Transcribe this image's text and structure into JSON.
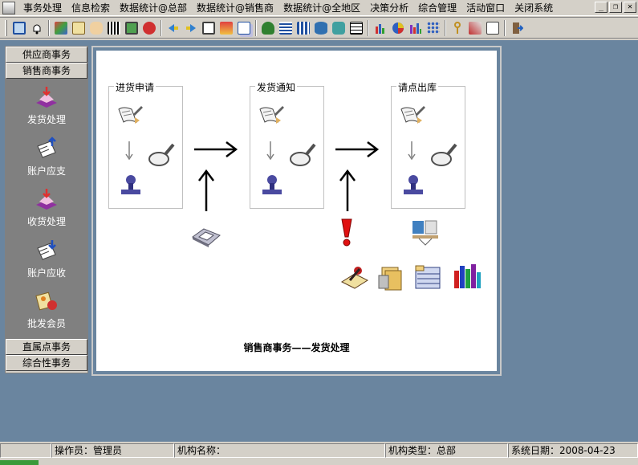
{
  "menubar": {
    "items": [
      "事务处理",
      "信息检索",
      "数据统计@总部",
      "数据统计@销售商",
      "数据统计@全地区",
      "决策分析",
      "综合管理",
      "活动窗口",
      "关闭系统"
    ]
  },
  "window_controls": {
    "minimize": "_",
    "restore": "❐",
    "close": "✕"
  },
  "toolbar": {
    "icons": [
      "window-icon",
      "bell-icon",
      "people-icon",
      "search-doc-icon",
      "hand-icon",
      "barcode-icon",
      "monitor-icon",
      "cart-icon",
      "arrow-left-icon",
      "arrow-right-icon",
      "print-icon",
      "layers-icon",
      "copy-icon",
      "money-bag-icon",
      "grid-icon",
      "columns-icon",
      "database-icon",
      "database-group-icon",
      "table-icon",
      "bar-chart-icon",
      "pie-chart-icon",
      "column-chart-icon",
      "dot-grid-icon",
      "key-icon",
      "tools-icon",
      "properties-icon",
      "exit-icon"
    ]
  },
  "leftpanel": {
    "sections": {
      "supplier": "供应商事务",
      "dealer": "销售商事务",
      "direct": "直属点事务",
      "general": "综合性事务"
    },
    "items": [
      {
        "label": "发货处理",
        "icon": "ship-icon"
      },
      {
        "label": "账户应支",
        "icon": "pay-icon"
      },
      {
        "label": "收货处理",
        "icon": "receive-icon"
      },
      {
        "label": "账户应收",
        "icon": "receivable-icon"
      },
      {
        "label": "批发会员",
        "icon": "member-icon"
      }
    ]
  },
  "workflow": {
    "groups": [
      "进货申请",
      "发货通知",
      "请点出库"
    ],
    "caption": "销售商事务——发货处理"
  },
  "statusbar": {
    "operator": "操作员：管理员",
    "org_name": "机构名称：",
    "org_type": "机构类型：总部",
    "system_date": "系统日期：2008-04-23"
  },
  "colors": {
    "desktop": "#6a859f",
    "panel": "#d4d0c8",
    "leftbody": "#808080"
  }
}
